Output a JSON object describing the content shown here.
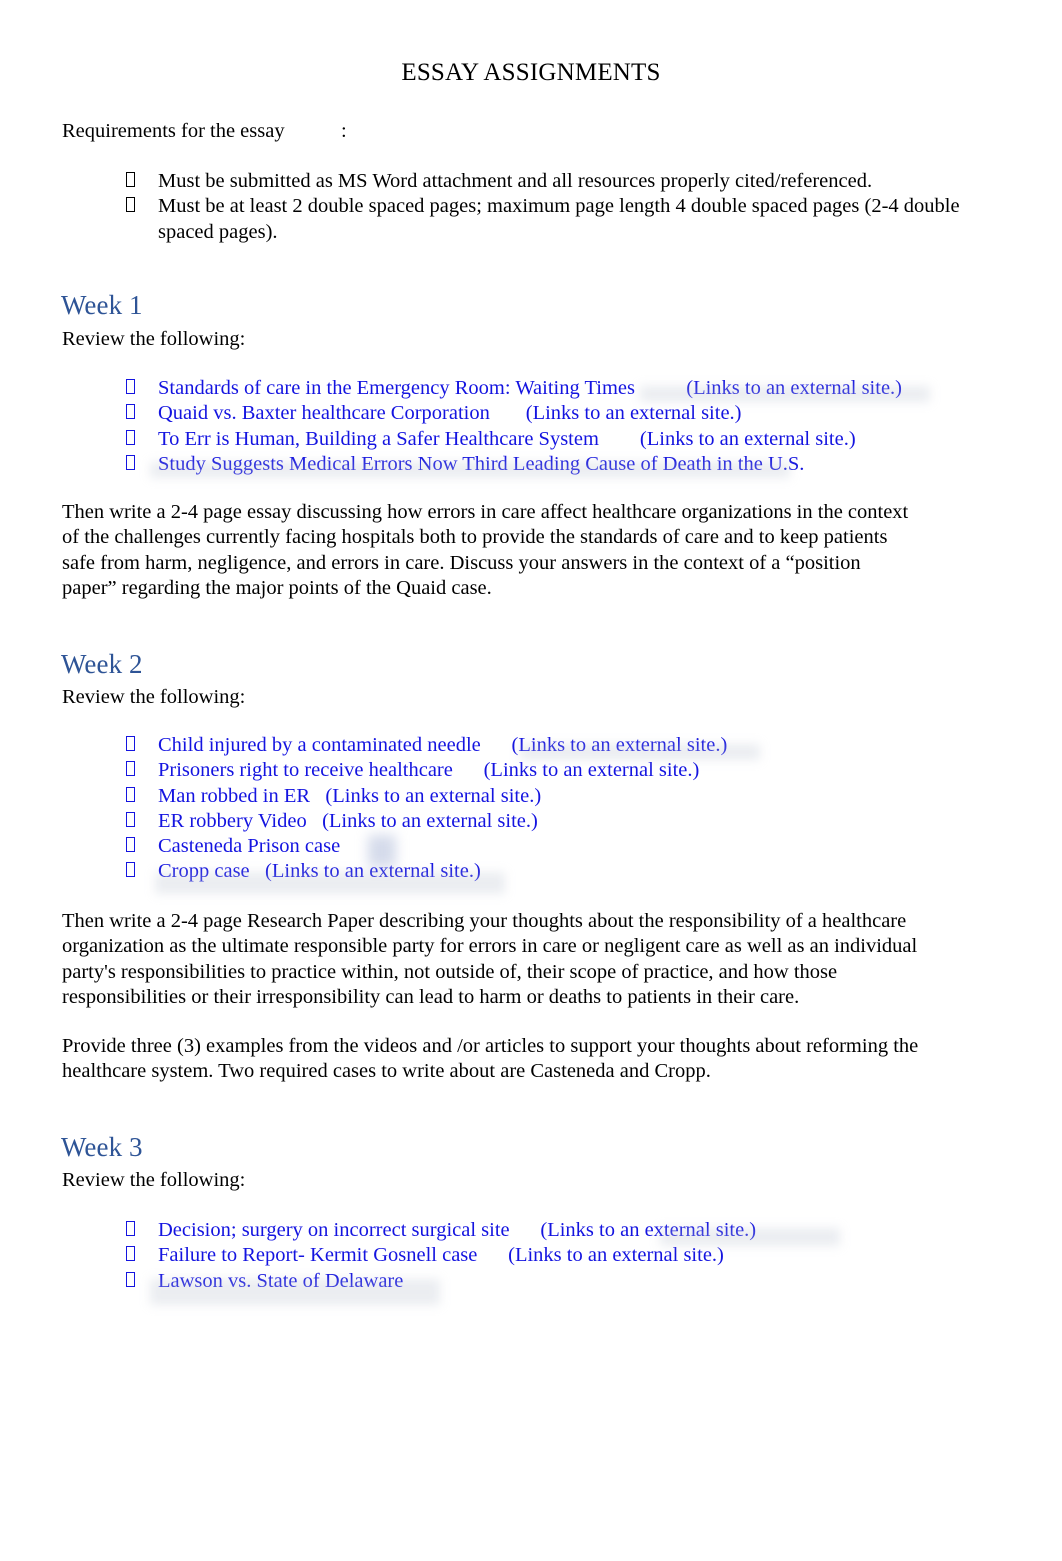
{
  "document": {
    "title": "ESSAY ASSIGNMENTS",
    "requirements_label": "Requirements for the essay           :",
    "review_label": "Review the following:",
    "link_suffix": "(Links to an external site.)",
    "colors": {
      "heading_blue": "#2e5496",
      "link_blue": "#1414e0",
      "body_black": "#000000",
      "page_background": "#ffffff"
    },
    "bullet_glyph": "missing-glyph-box"
  },
  "requirements": {
    "items": [
      "Must be submitted as MS Word attachment and all resources properly cited/referenced.",
      "Must be at least 2 double spaced pages; maximum page length 4 double spaced pages (2-4 double spaced pages)."
    ]
  },
  "weeks": [
    {
      "heading": "Week 1",
      "review_label": "Review the following:",
      "links": [
        "Standards of care in the Emergency Room: Waiting Times          (Links to an external site.)",
        "Quaid vs. Baxter healthcare Corporation       (Links to an external site.)",
        "To Err is Human, Building a Safer Healthcare System        (Links to an external site.)",
        "Study Suggests Medical Errors Now Third Leading Cause of Death in the U.S."
      ],
      "paragraphs": [
        "Then write a   2-4 page essay      discussing how errors in care affect healthcare organizations in the context of the challenges currently facing hospitals both to provide the standards of care and to keep patients safe from harm, negligence, and errors in care. Discuss your answers in the context of a “position paper” regarding the major points of the Quaid case."
      ]
    },
    {
      "heading": "Week 2",
      "review_label": "Review the following:",
      "links": [
        "Child injured by a contaminated needle      (Links to an external site.)",
        "Prisoners right to receive healthcare      (Links to an external site.)",
        "Man robbed in ER   (Links to an external site.)",
        "ER robbery Video   (Links to an external site.)",
        "Casteneda Prison case",
        "Cropp case   (Links to an external site.)"
      ],
      "paragraphs": [
        "Then write a   2-4 page Research Paper        describing your thoughts about the responsibility of a healthcare organization as the ultimate responsible party for errors in care or negligent care as well as an individual party's responsibilities to practice within, not outside of, their scope of practice, and how those responsibilities or their irresponsibility can lead to harm or deaths to patients in their care.",
        "Provide three (3) examples from the videos and /or articles to support your thoughts about reforming the healthcare system. Two required cases to write about are Casteneda and Cropp."
      ]
    },
    {
      "heading": "Week 3",
      "review_label": "Review the following:",
      "links": [
        "Decision; surgery on incorrect surgical site      (Links to an external site.)",
        "Failure to Report- Kermit Gosnell case      (Links to an external site.)",
        "Lawson vs. State of Delaware"
      ],
      "paragraphs": []
    }
  ]
}
